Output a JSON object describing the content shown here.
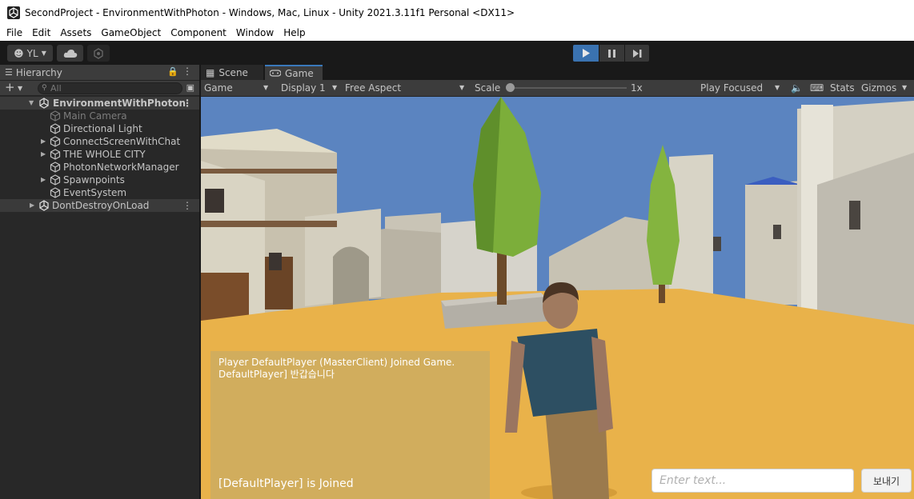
{
  "window": {
    "title": "SecondProject - EnvironmentWithPhoton - Windows, Mac, Linux - Unity 2021.3.11f1 Personal <DX11>"
  },
  "menu": [
    "File",
    "Edit",
    "Assets",
    "GameObject",
    "Component",
    "Window",
    "Help"
  ],
  "toolbar": {
    "account_label": "YL"
  },
  "hierarchy": {
    "tab_label": "Hierarchy",
    "search_placeholder": "All",
    "items": [
      {
        "label": "EnvironmentWithPhoton"
      },
      {
        "label": "Main Camera"
      },
      {
        "label": "Directional Light"
      },
      {
        "label": "ConnectScreenWithChat"
      },
      {
        "label": "THE WHOLE CITY"
      },
      {
        "label": "PhotonNetworkManager"
      },
      {
        "label": "Spawnpoints"
      },
      {
        "label": "EventSystem"
      },
      {
        "label": "DontDestroyOnLoad"
      }
    ]
  },
  "game_view": {
    "tabs": [
      "Scene",
      "Game"
    ],
    "mode": "Game",
    "display": "Display 1",
    "aspect": "Free Aspect",
    "scale_label": "Scale",
    "scale_value": "1x",
    "scale_fraction": 0.0,
    "play_mode": "Play Focused",
    "stats_label": "Stats",
    "gizmos_label": "Gizmos"
  },
  "chat": {
    "messages": [
      "Player DefaultPlayer (MasterClient) Joined Game.",
      "DefaultPlayer] 반갑습니다"
    ],
    "status": "[DefaultPlayer] is Joined",
    "input_placeholder": "Enter text...",
    "send_label": "보내기"
  },
  "colors": {
    "accent": "#3a72b0",
    "ground": "#e9b24a",
    "sky": "#5b84c0",
    "panel": "#282828"
  }
}
